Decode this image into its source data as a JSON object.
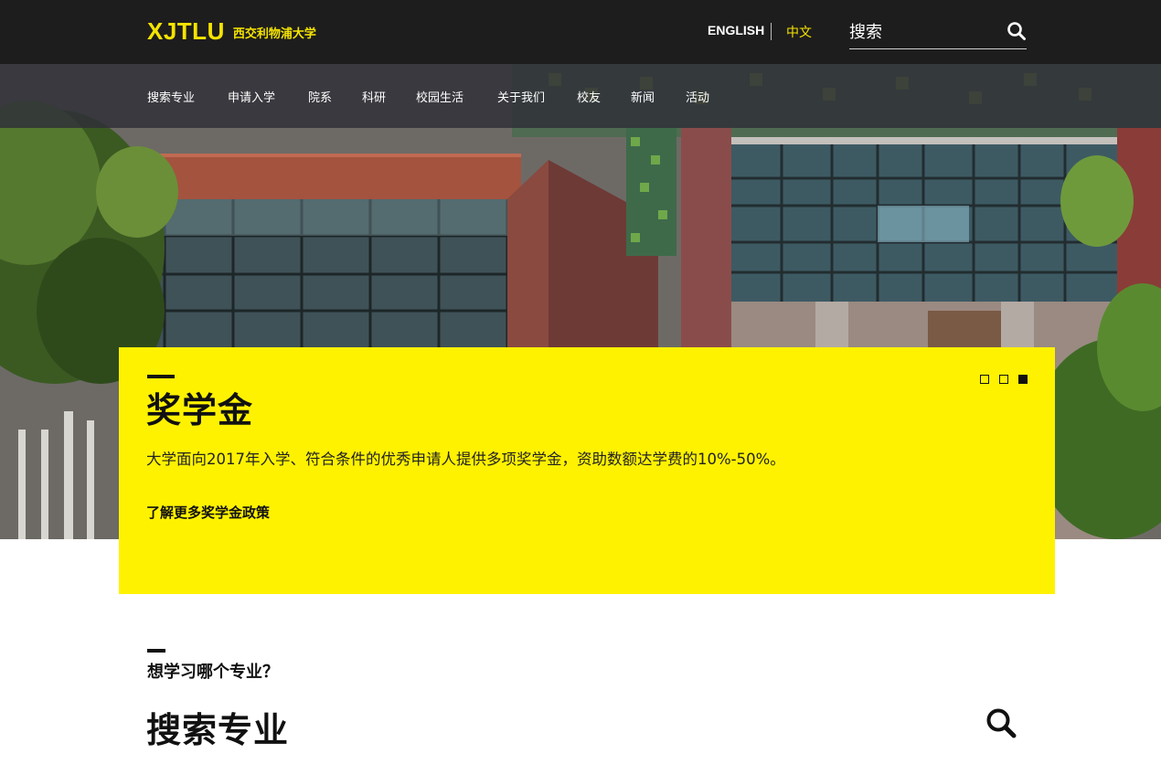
{
  "header": {
    "logo_main": "XJTLU",
    "logo_sub": "西交利物浦大学",
    "lang_en": "ENGLISH",
    "lang_zh": "中文",
    "search_placeholder": "搜索"
  },
  "nav": {
    "items": [
      "搜索专业",
      "申请入学",
      "院系",
      "科研",
      "校园生活",
      "关于我们",
      "校友",
      "新闻",
      "活动"
    ]
  },
  "slide": {
    "title": "奖学金",
    "description": "大学面向2017年入学、符合条件的优秀申请人提供多项奖学金，资助数额达学费的10%-50%。",
    "link": "了解更多奖学金政策",
    "total_slides": 3,
    "active_slide": 3
  },
  "programs": {
    "question": "想学习哪个专业？",
    "title": "搜索专业"
  },
  "colors": {
    "accent_yellow": "#fff200",
    "logo_yellow": "#f5e400",
    "topbar": "#181818",
    "text_dark": "#111111"
  },
  "icons": [
    "search-icon",
    "slide-dot"
  ]
}
